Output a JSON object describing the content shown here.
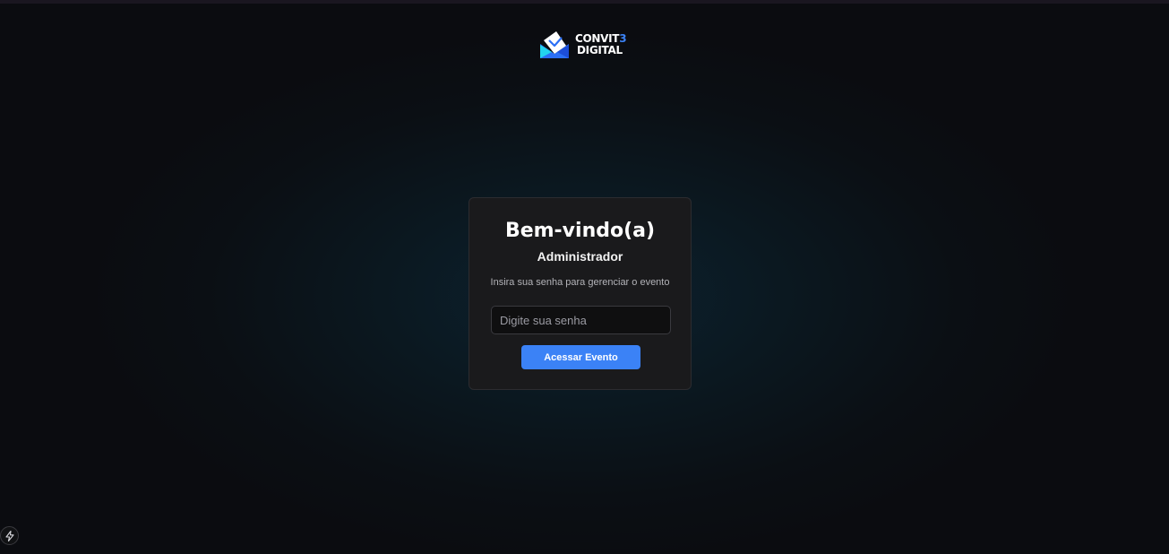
{
  "brand": {
    "line1_main": "CONVIT",
    "line1_accent": "3",
    "line2": "DIGITAL",
    "colors": {
      "accent": "#3b82f6",
      "mark_light": "#ffffff",
      "mark_blue": "#2b6ff5",
      "mark_teal": "#22d3ee"
    }
  },
  "login": {
    "title": "Bem-vindo(a)",
    "subtitle": "Administrador",
    "instructions": "Insira sua senha para gerenciar o evento",
    "password_placeholder": "Digite sua senha",
    "password_value": "",
    "submit_label": "Acessar Evento"
  },
  "dev_badge": {
    "icon": "lightning-bolt-icon"
  },
  "theme": {
    "background": "#0b0c10",
    "card_background": "#1a1a1c",
    "button_color": "#3b82f6"
  }
}
